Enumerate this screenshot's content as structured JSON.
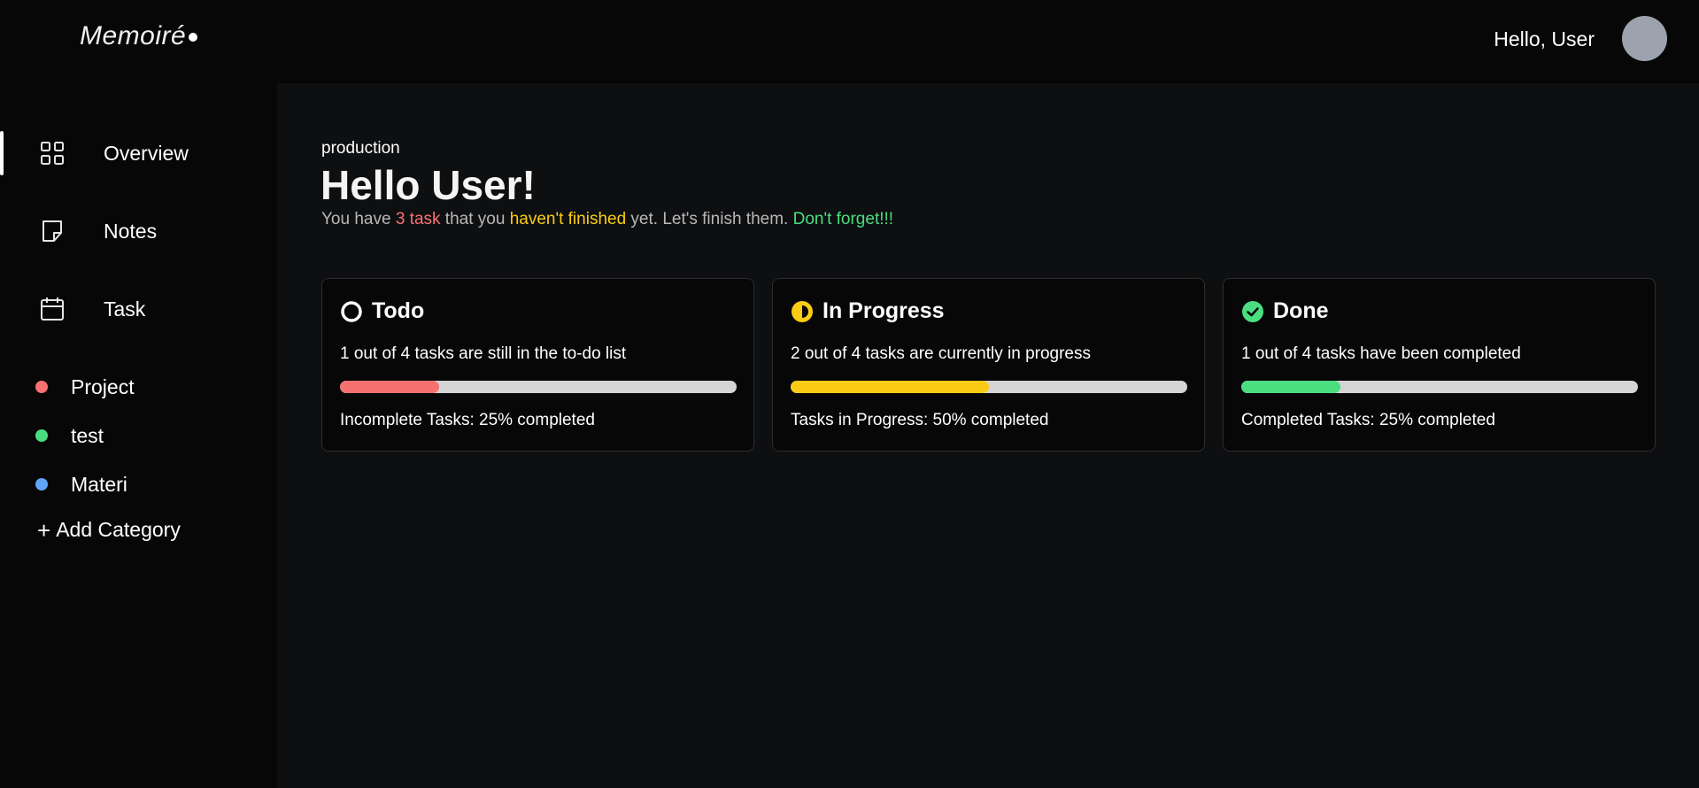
{
  "header": {
    "logo": "Memoiré",
    "greeting": "Hello, User"
  },
  "sidebar": {
    "nav": [
      {
        "label": "Overview",
        "icon": "grid-icon",
        "active": true
      },
      {
        "label": "Notes",
        "icon": "sticky-note-icon",
        "active": false
      },
      {
        "label": "Task",
        "icon": "calendar-icon",
        "active": false
      }
    ],
    "categories": [
      {
        "label": "Project",
        "color": "#f87171"
      },
      {
        "label": "test",
        "color": "#4ade80"
      },
      {
        "label": "Materi",
        "color": "#60a5fa"
      }
    ],
    "add_category_label": "Add Category"
  },
  "main": {
    "workspace": "production",
    "title": "Hello User!",
    "subtitle": {
      "part1": "You have ",
      "count": "3 task",
      "part2": " that you ",
      "status": "haven't finished",
      "part3": " yet. Let's finish them. ",
      "reminder": "Don't forget!!!"
    },
    "cards": [
      {
        "title": "Todo",
        "icon": "circle-outline-icon",
        "desc": "1 out of 4 tasks are still in the to-do list",
        "progress": 0.25,
        "color": "#f87171",
        "footer": "Incomplete Tasks: 25% completed"
      },
      {
        "title": "In Progress",
        "icon": "half-circle-icon",
        "desc": "2 out of 4 tasks are currently in progress",
        "progress": 0.5,
        "color": "#facc15",
        "footer": "Tasks in Progress: 50% completed"
      },
      {
        "title": "Done",
        "icon": "check-circle-icon",
        "desc": "1 out of 4 tasks have been completed",
        "progress": 0.25,
        "color": "#4ade80",
        "footer": "Completed Tasks: 25% completed"
      }
    ]
  }
}
